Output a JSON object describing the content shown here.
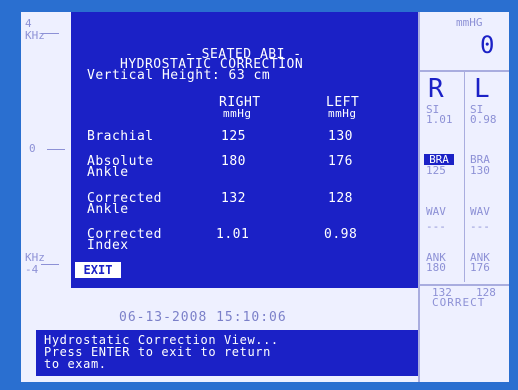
{
  "axis": {
    "top_value": "4",
    "top_unit": "KHz",
    "middle_value": "0",
    "bottom_unit": "KHz",
    "bottom_value": "-4"
  },
  "pressure": {
    "unit": "mmHG",
    "value": "0"
  },
  "header": {
    "line1": "- SEATED ABI -",
    "line2": "HYDROSTATIC CORRECTION",
    "line3": "Vertical Height: 63 cm"
  },
  "columns": {
    "right": "RIGHT",
    "left": "LEFT",
    "unit": "mmHg"
  },
  "rows": [
    {
      "label1": "Brachial",
      "label2": "",
      "right": "125",
      "left": "130"
    },
    {
      "label1": "Absolute",
      "label2": "Ankle",
      "right": "180",
      "left": "176"
    },
    {
      "label1": "Corrected",
      "label2": "Ankle",
      "right": "132",
      "left": "128"
    },
    {
      "label1": "Corrected",
      "label2": "Index",
      "right": "1.01",
      "left": "0.98"
    }
  ],
  "exit_label": "EXIT",
  "side": {
    "r": "R",
    "l": "L",
    "si_label": "SI",
    "si_r": "1.01",
    "si_l": "0.98",
    "bra": "BRA",
    "bra_r": "125",
    "bra_l": "130",
    "wav": "WAV",
    "dash": "---",
    "ank": "ANK",
    "ank_r": "180",
    "ank_l": "176",
    "correct_r": "132",
    "correct_l": "128",
    "correct": "CORRECT"
  },
  "datetime": "06-13-2008 15:10:06",
  "message": [
    "Hydrostatic Correction View...",
    "Press ENTER to exit to return",
    "to exam."
  ]
}
